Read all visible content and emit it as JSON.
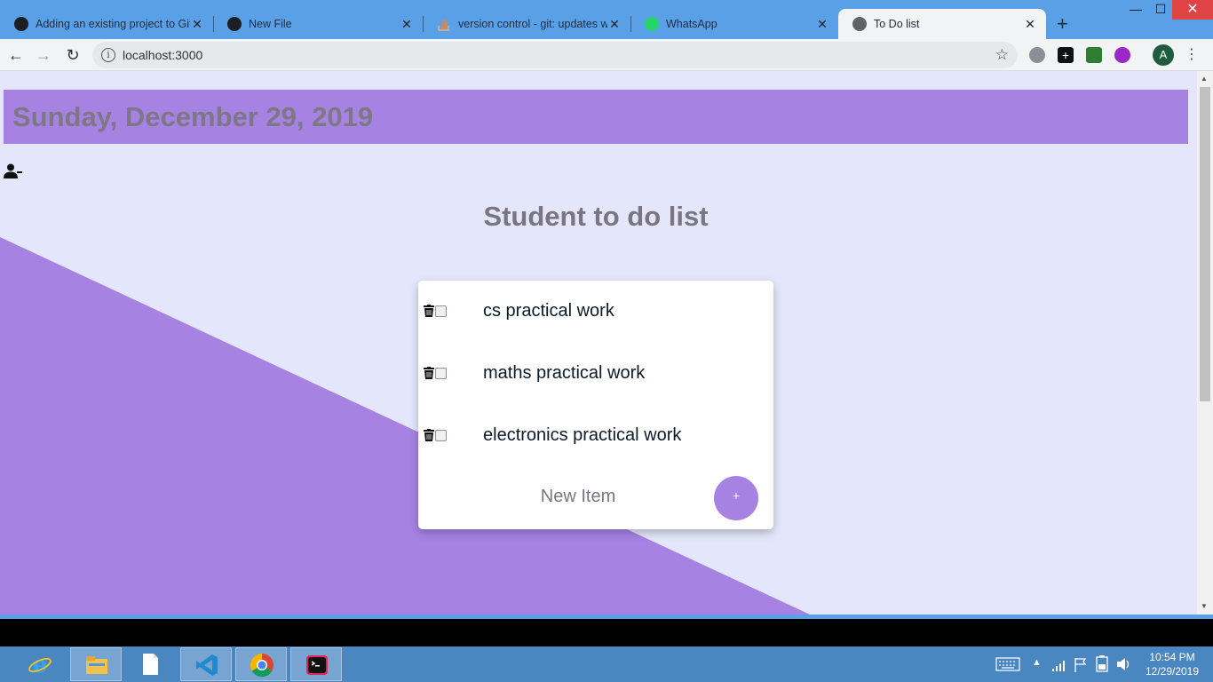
{
  "browser": {
    "tabs": [
      {
        "title": "Adding an existing project to Git",
        "icon": "github-icon"
      },
      {
        "title": "New File",
        "icon": "github-icon"
      },
      {
        "title": "version control - git: updates we",
        "icon": "stackoverflow-icon"
      },
      {
        "title": "WhatsApp",
        "icon": "whatsapp-icon"
      },
      {
        "title": "To Do list",
        "icon": "globe-icon"
      }
    ],
    "url": "localhost:3000",
    "profile_initial": "A"
  },
  "page": {
    "date": "Sunday, December 29, 2019",
    "title": "Student to do list",
    "items": [
      {
        "text": "cs practical work",
        "checked": false
      },
      {
        "text": "maths practical work",
        "checked": false
      },
      {
        "text": "electronics practical work",
        "checked": false
      }
    ],
    "new_item_placeholder": "New Item",
    "add_button_label": "+",
    "colors": {
      "accent": "#a683e3",
      "background": "#e4e7fb",
      "header_text": "#7e7785"
    }
  },
  "taskbar": {
    "apps": [
      "internet-explorer-icon",
      "file-explorer-icon",
      "notepad-icon",
      "vscode-icon",
      "chrome-icon",
      "terminal-icon"
    ],
    "time": "10:54 PM",
    "date": "12/29/2019"
  }
}
